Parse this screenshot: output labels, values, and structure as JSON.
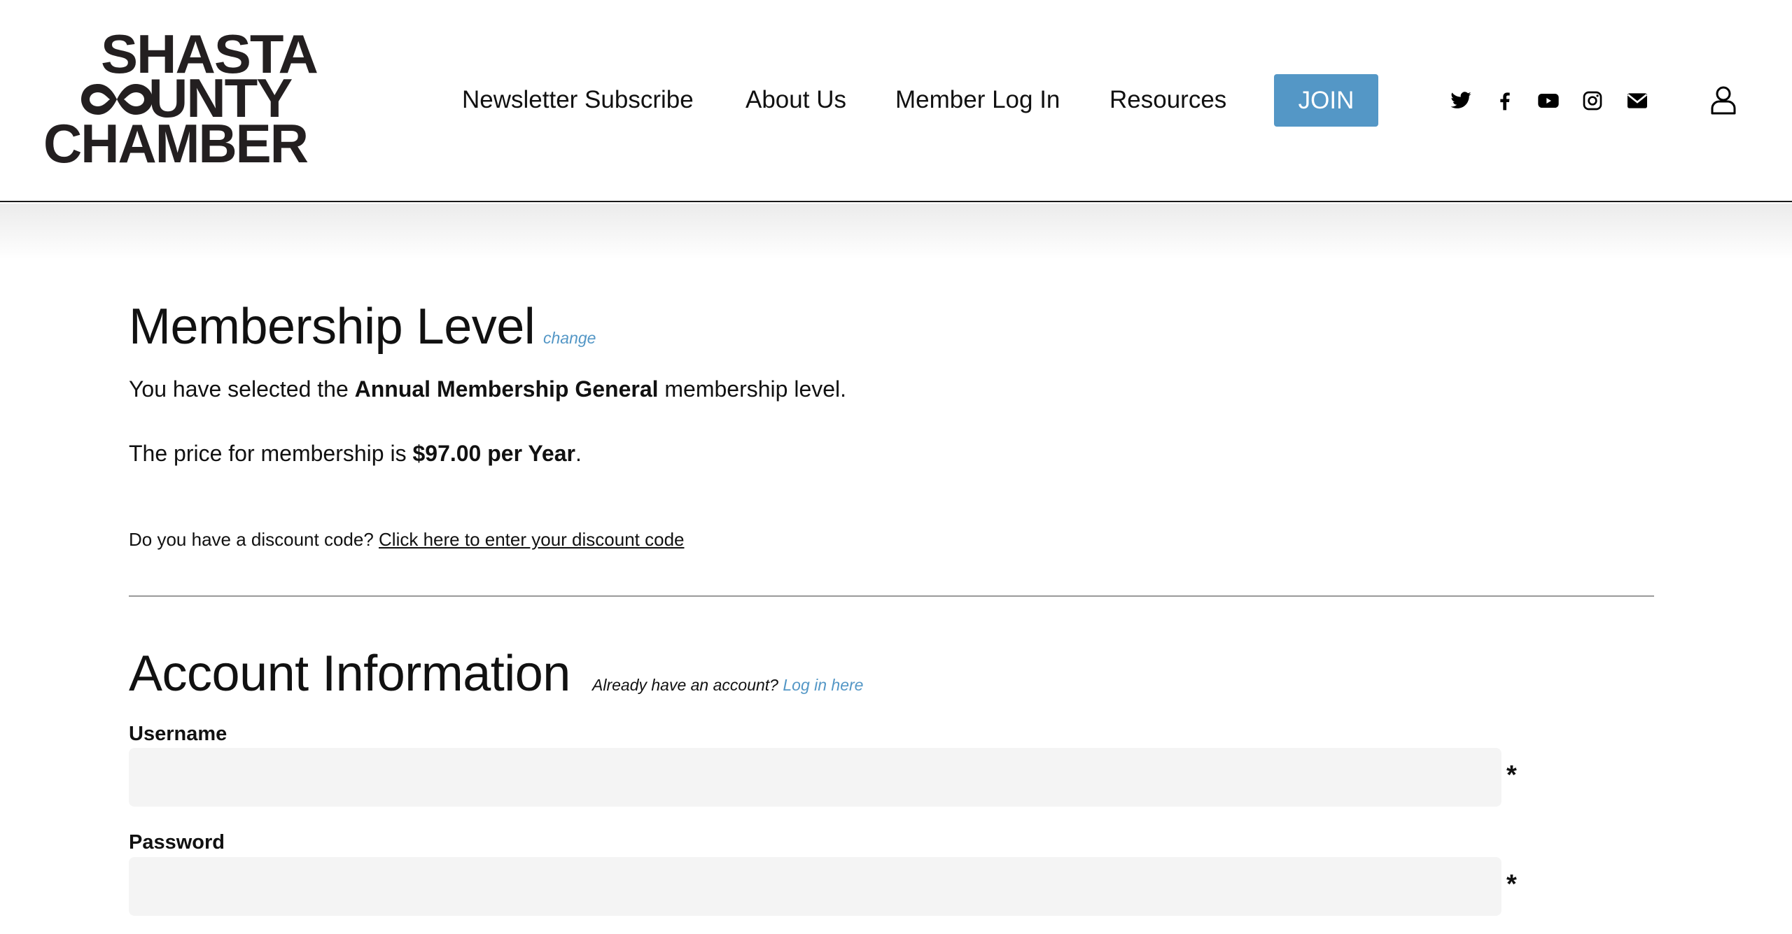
{
  "header": {
    "logo": {
      "line1": "SHASTA",
      "line2": "UNTY",
      "line3": "CHAMBER",
      "alt_text": "Shasta County Chamber",
      "infinity_symbol": "infinity-icon"
    },
    "nav": [
      {
        "label": "Newsletter Subscribe"
      },
      {
        "label": "About Us"
      },
      {
        "label": "Member Log In"
      },
      {
        "label": "Resources"
      }
    ],
    "join_label": "JOIN",
    "join_color": "#5497c6",
    "social_icons": [
      "twitter-icon",
      "facebook-icon",
      "youtube-icon",
      "instagram-icon",
      "email-icon"
    ],
    "account_icon": "user-icon"
  },
  "membership": {
    "title": "Membership Level",
    "change_link": "change",
    "selected_prefix": "You have selected the ",
    "selected_level": "Annual Membership General",
    "selected_suffix": " membership level.",
    "price_prefix": "The price for membership is ",
    "price_value": "$97.00 per Year",
    "price_suffix": ".",
    "discount_question": "Do you have a discount code? ",
    "discount_link": "Click here to enter your discount code"
  },
  "account": {
    "title": "Account Information",
    "already_text": "Already have an account? ",
    "login_link": "Log in here",
    "fields": [
      {
        "label": "Username",
        "value": "",
        "required_marker": "*"
      },
      {
        "label": "Password",
        "value": "",
        "required_marker": "*"
      }
    ]
  },
  "colors": {
    "accent": "#5497c6",
    "input_bg": "#f4f4f4",
    "text": "#111111"
  }
}
